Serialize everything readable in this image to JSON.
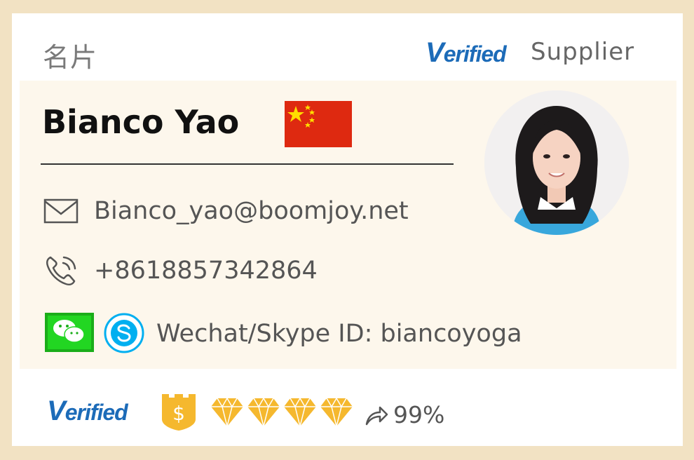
{
  "header": {
    "title": "名片",
    "verified_badge": {
      "first": "V",
      "rest": "erified"
    },
    "supplier_label": "Supplier"
  },
  "profile": {
    "name": "Bianco Yao",
    "country_flag": "china-flag-icon",
    "photo": "profile-photo"
  },
  "contact": {
    "email": "Bianco_yao@boomjoy.net",
    "phone": "+8618857342864",
    "im_label": "Wechat/Skype ID: biancoyoga",
    "icons": [
      "mail-icon",
      "phone-icon",
      "wechat-icon",
      "skype-icon"
    ]
  },
  "footer": {
    "verified_badge": {
      "first": "V",
      "rest": "erified"
    },
    "gold_supplier_icon": "gold-shield-dollar-icon",
    "diamonds": 4,
    "response_rate": "99%"
  },
  "colors": {
    "page_border": "#f2e2c3",
    "panel": "#fdf7ec",
    "verified_blue": "#1c6bb8",
    "text_gray": "#555555",
    "gold": "#f5b82e",
    "flag_red": "#de2910",
    "flag_yellow": "#ffde00",
    "wechat_green": "#1aad19",
    "skype_blue": "#00aff0"
  }
}
